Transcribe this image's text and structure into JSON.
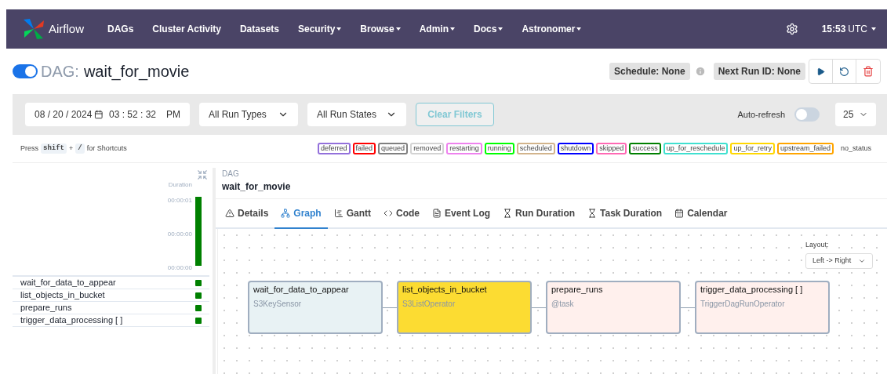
{
  "navbar": {
    "brand": "Airflow",
    "items": [
      {
        "label": "DAGs",
        "dropdown": false
      },
      {
        "label": "Cluster Activity",
        "dropdown": false
      },
      {
        "label": "Datasets",
        "dropdown": false
      },
      {
        "label": "Security",
        "dropdown": true
      },
      {
        "label": "Browse",
        "dropdown": true
      },
      {
        "label": "Admin",
        "dropdown": true
      },
      {
        "label": "Docs",
        "dropdown": true
      },
      {
        "label": "Astronomer",
        "dropdown": true
      }
    ],
    "time": "15:53",
    "timezone": "UTC"
  },
  "header": {
    "paused_toggle": {
      "on": true
    },
    "prefix": "DAG:",
    "dag_id": "wait_for_movie",
    "schedule": "Schedule: None",
    "next_run": "Next Run ID: None"
  },
  "filters": {
    "date": "08 / 20 / 2024",
    "time": "03 : 52 : 32",
    "ampm": "PM",
    "run_types": "All Run Types",
    "run_states": "All Run States",
    "clear": "Clear Filters",
    "auto_refresh": {
      "label": "Auto-refresh",
      "on": false
    },
    "page_size": "25"
  },
  "shortcuts": {
    "press": "Press",
    "key1": "shift",
    "plus": "+",
    "key2": "/",
    "suffix": "for Shortcuts"
  },
  "legend": [
    {
      "label": "deferred",
      "color": "#9370db"
    },
    {
      "label": "failed",
      "color": "#ff0000"
    },
    {
      "label": "queued",
      "color": "#808080"
    },
    {
      "label": "removed",
      "color": "#d3d3d3"
    },
    {
      "label": "restarting",
      "color": "#ee82ee"
    },
    {
      "label": "running",
      "color": "#00ff00"
    },
    {
      "label": "scheduled",
      "color": "#d2b48c"
    },
    {
      "label": "shutdown",
      "color": "#0000ff"
    },
    {
      "label": "skipped",
      "color": "#ff69b4"
    },
    {
      "label": "success",
      "color": "#008000"
    },
    {
      "label": "up_for_reschedule",
      "color": "#40e0d0"
    },
    {
      "label": "up_for_retry",
      "color": "#ffd700"
    },
    {
      "label": "upstream_failed",
      "color": "#ffa500"
    },
    {
      "label": "no_status"
    }
  ],
  "grid": {
    "duration_label": "Duration",
    "ticks": [
      "00:00:01",
      "00:00:00",
      "00:00:00"
    ],
    "tasks": [
      {
        "name": "wait_for_data_to_appear",
        "color": "#008000"
      },
      {
        "name": "list_objects_in_bucket",
        "color": "#008000"
      },
      {
        "name": "prepare_runs",
        "color": "#008000"
      },
      {
        "name": "trigger_data_processing [ ]",
        "color": "#008000"
      }
    ]
  },
  "details": {
    "kicker": "DAG",
    "title": "wait_for_movie",
    "tabs": [
      {
        "label": "Details",
        "selected": false
      },
      {
        "label": "Graph",
        "selected": true
      },
      {
        "label": "Gantt",
        "selected": false
      },
      {
        "label": "Code",
        "selected": false
      },
      {
        "label": "Event Log",
        "selected": false
      },
      {
        "label": "Run Duration",
        "selected": false
      },
      {
        "label": "Task Duration",
        "selected": false
      },
      {
        "label": "Calendar",
        "selected": false
      }
    ]
  },
  "graph": {
    "layout_label": "Layout:",
    "layout": "Left -> Right",
    "nodes": [
      {
        "name": "wait_for_data_to_appear",
        "operator": "S3KeySensor",
        "color": "#e8f2f4"
      },
      {
        "name": "list_objects_in_bucket",
        "operator": "S3ListOperator",
        "color": "#fcdc32"
      },
      {
        "name": "prepare_runs",
        "operator": "@task",
        "color": "#fff0ed"
      },
      {
        "name": "trigger_data_processing [ ]",
        "operator": "TriggerDagRunOperator",
        "color": "#fff0ed"
      }
    ]
  }
}
